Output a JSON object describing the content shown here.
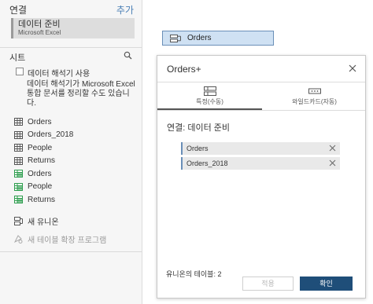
{
  "connections": {
    "title": "연결",
    "add_label": "추가",
    "items": [
      {
        "name": "데이터 준비",
        "type": "Microsoft Excel"
      }
    ]
  },
  "sheets": {
    "title": "시트",
    "interpreter": {
      "checkbox_label": "데이터 해석기 사용",
      "description": "데이터 해석기가 Microsoft Excel 통합 문서를 정리할 수도 있습니다."
    },
    "items": [
      {
        "label": "Orders",
        "icon": "table-icon"
      },
      {
        "label": "Orders_2018",
        "icon": "table-icon"
      },
      {
        "label": "People",
        "icon": "table-icon"
      },
      {
        "label": "Returns",
        "icon": "table-icon"
      },
      {
        "label": "Orders",
        "icon": "named-range-icon"
      },
      {
        "label": "People",
        "icon": "named-range-icon"
      },
      {
        "label": "Returns",
        "icon": "named-range-icon"
      }
    ],
    "new_union": "새 유니온",
    "new_extension": "새 테이블 확장 프로그램"
  },
  "canvas": {
    "table_pill": "Orders"
  },
  "dialog": {
    "title": "Orders+",
    "tabs": [
      {
        "label": "특정(수동)",
        "active": true
      },
      {
        "label": "와일드카드(자동)",
        "active": false
      }
    ],
    "connection_label": "연결: 데이터 준비",
    "tables": [
      "Orders",
      "Orders_2018"
    ],
    "count_label": "유니온의 테이블: 2",
    "apply_label": "적용",
    "ok_label": "확인"
  },
  "colors": {
    "accent": "#1f4e79",
    "pill_bg": "#cfe1f3",
    "named_range_green": "#2e9d4e",
    "link_blue": "#4a7fb5"
  }
}
